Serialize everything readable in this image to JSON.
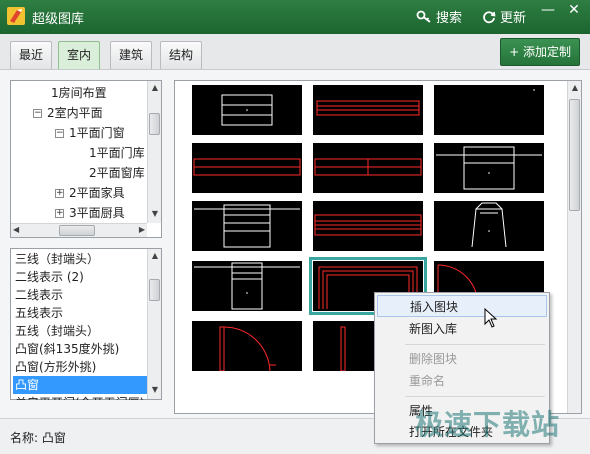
{
  "window": {
    "title": "超级图库",
    "search_label": "搜索",
    "refresh_label": "更新",
    "minimize": "—",
    "close": "✕"
  },
  "tabs": [
    {
      "label": "最近",
      "active": false
    },
    {
      "label": "室内",
      "active": true
    },
    {
      "label": "建筑",
      "active": false
    },
    {
      "label": "结构",
      "active": false
    }
  ],
  "add_button": "+ 添加定制",
  "tree": [
    {
      "label": "1房间布置"
    },
    {
      "label": "2室内平面",
      "expander": "−"
    },
    {
      "label": "1平面门窗",
      "expander": "−"
    },
    {
      "label": "1平面门库"
    },
    {
      "label": "2平面窗库"
    },
    {
      "label": "2平面家具",
      "expander": "+"
    },
    {
      "label": "3平面厨具",
      "expander": "+"
    }
  ],
  "list": [
    "三线（封端头）",
    "二线表示 (2)",
    "二线表示",
    "五线表示",
    "五线（封端头）",
    "凸窗(斜135度外挑)",
    "凸窗(方形外挑)",
    "凸窗",
    "单扇平开门(全开无门厚)"
  ],
  "selected_list_index": 7,
  "context_menu": {
    "items": [
      "插入图块",
      "新图入库",
      "删除图块",
      "重命名",
      "属性",
      "打开所在文件夹"
    ],
    "disabled": [
      2,
      3
    ],
    "highlighted": 0
  },
  "status": {
    "label": "名称: 凸窗"
  },
  "watermark": "极速下载站",
  "colors": {
    "accent": "#1f6b33",
    "selection": "#3399ff",
    "thumb_line": "#ff2a2a",
    "thumb_bg": "#000000"
  }
}
